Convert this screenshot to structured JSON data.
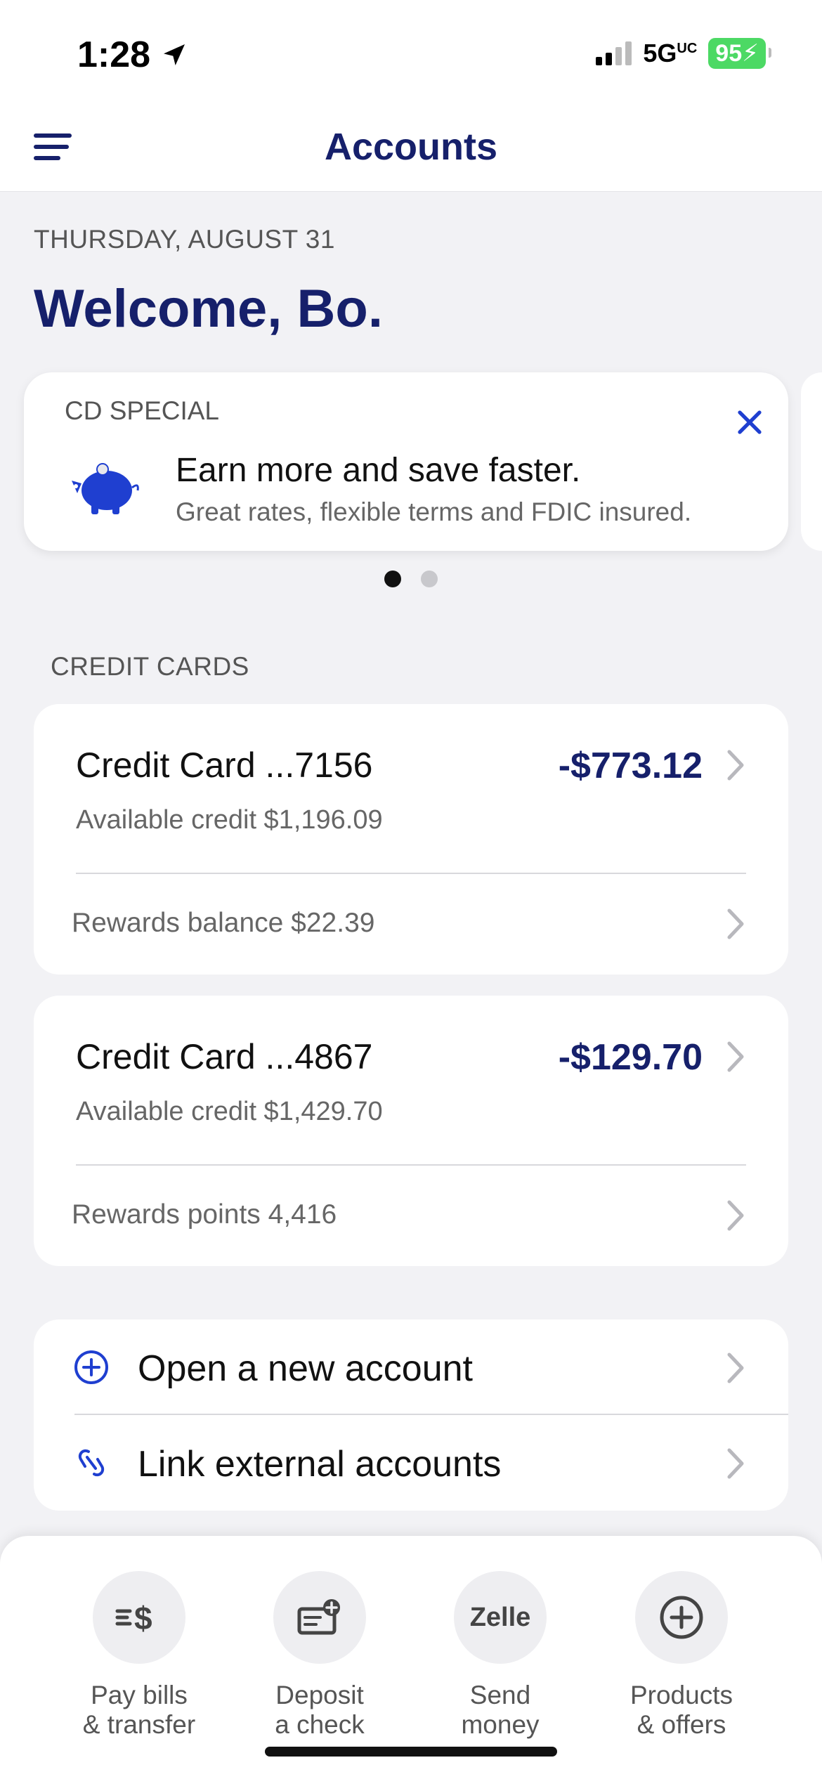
{
  "status_bar": {
    "time": "1:28",
    "network": "5G",
    "network_sup": "UC",
    "battery": "95"
  },
  "header": {
    "title": "Accounts"
  },
  "date": "THURSDAY, AUGUST 31",
  "welcome": "Welcome, Bo.",
  "promo": {
    "tag": "CD SPECIAL",
    "title": "Earn more and save faster.",
    "subtitle": "Great rates, flexible terms and FDIC insured.",
    "icon": "piggy-bank-icon",
    "page_index": 1,
    "page_count": 2
  },
  "section_label": "CREDIT CARDS",
  "accounts": [
    {
      "name": "Credit Card ...7156",
      "amount": "-$773.12",
      "available": "Available credit $1,196.09",
      "rewards": "Rewards balance $22.39"
    },
    {
      "name": "Credit Card ...4867",
      "amount": "-$129.70",
      "available": "Available credit $1,429.70",
      "rewards": "Rewards points 4,416"
    }
  ],
  "actions": [
    {
      "label": "Open a new account",
      "icon": "plus-circle-icon"
    },
    {
      "label": "Link external accounts",
      "icon": "link-icon"
    }
  ],
  "bottom_nav": [
    {
      "line1": "Pay bills",
      "line2": "& transfer",
      "icon": "pay-bills-icon"
    },
    {
      "line1": "Deposit",
      "line2": "a check",
      "icon": "deposit-check-icon"
    },
    {
      "line1": "Send",
      "line2": "money",
      "icon": "zelle-icon",
      "icon_text": "Zelle"
    },
    {
      "line1": "Products",
      "line2": "& offers",
      "icon": "plus-circle-icon"
    }
  ],
  "colors": {
    "brand_navy": "#16206b",
    "accent_blue": "#1f3fd0",
    "background": "#f2f2f5",
    "battery_green": "#4cd964"
  }
}
